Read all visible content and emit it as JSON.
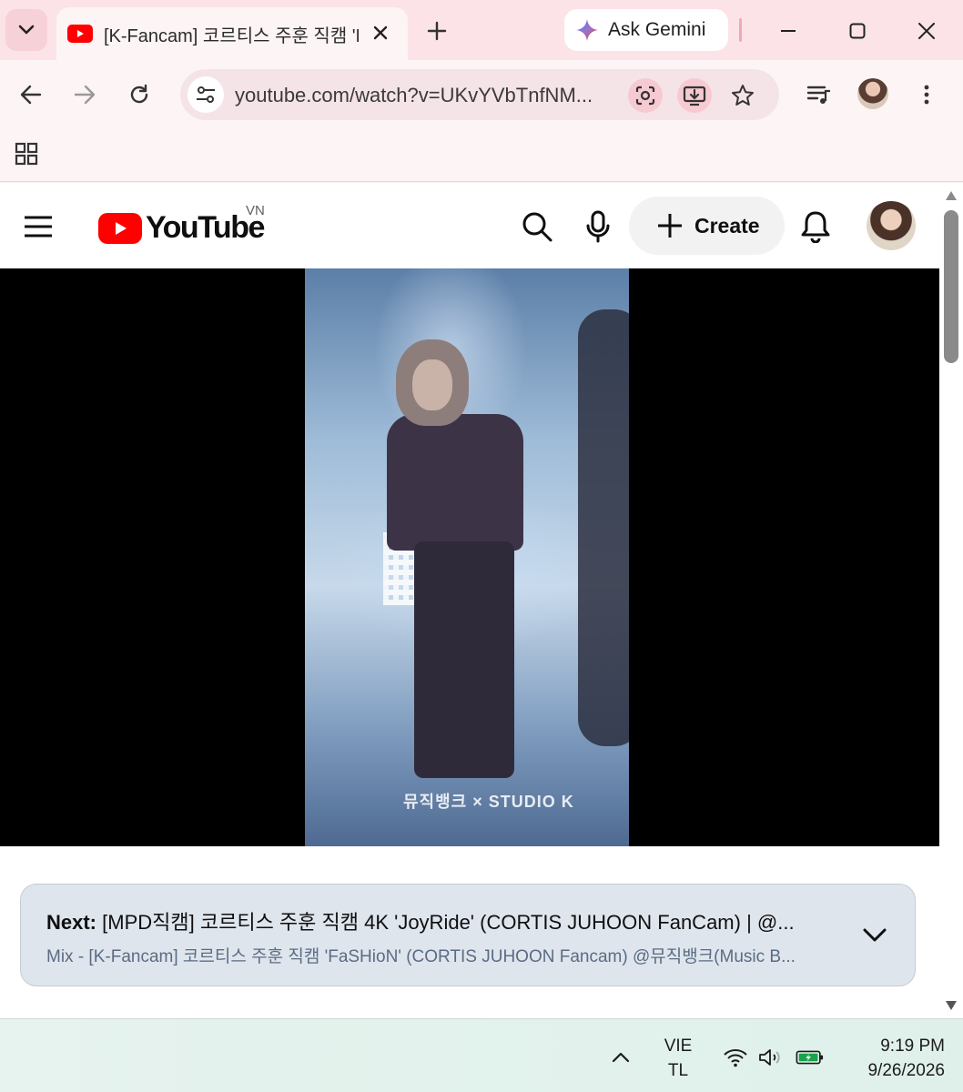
{
  "browser": {
    "tab": {
      "title": "[K-Fancam] 코르티스 주훈 직캠 'FaSHioN' (CORTIS JUHOON Fancam) @뮤직뱅크(Music Bank)"
    },
    "gemini_label": "Ask Gemini",
    "url": "youtube.com/watch?v=UKvYVbTnfNM...",
    "icons": {
      "tab_search": "chevron-down-icon",
      "favicon": "youtube-favicon-icon",
      "close_tab": "close-icon",
      "new_tab": "plus-icon",
      "gemini": "gemini-sparkle-icon",
      "minimize": "minimize-icon",
      "maximize": "maximize-icon",
      "close_window": "close-icon",
      "back": "arrow-left-icon",
      "forward": "arrow-right-icon",
      "reload": "reload-icon",
      "site_info": "tune-icon",
      "lens": "lens-icon",
      "install": "install-app-icon",
      "bookmark": "star-icon",
      "media": "media-queue-icon",
      "menu": "more-vert-icon",
      "apps": "apps-grid-icon"
    },
    "accent_color": "#f7cad2"
  },
  "youtube": {
    "logo_text": "YouTube",
    "region": "VN",
    "create_label": "Create",
    "watermark": "뮤직뱅크 × STUDIO K",
    "next": {
      "prefix": "Next:",
      "title": "[MPD직캠] 코르티스 주훈 직캠 4K 'JoyRide' (CORTIS JUHOON FanCam) | @...",
      "playlist": "Mix - [K-Fancam] 코르티스 주훈 직캠 'FaSHioN' (CORTIS JUHOON Fancam) @뮤직뱅크(Music B..."
    },
    "brand_color": "#ff0000"
  },
  "taskbar": {
    "lang_line1": "VIE",
    "lang_line2": "TL",
    "time": "9:19 PM",
    "date": "9/26/2026"
  }
}
